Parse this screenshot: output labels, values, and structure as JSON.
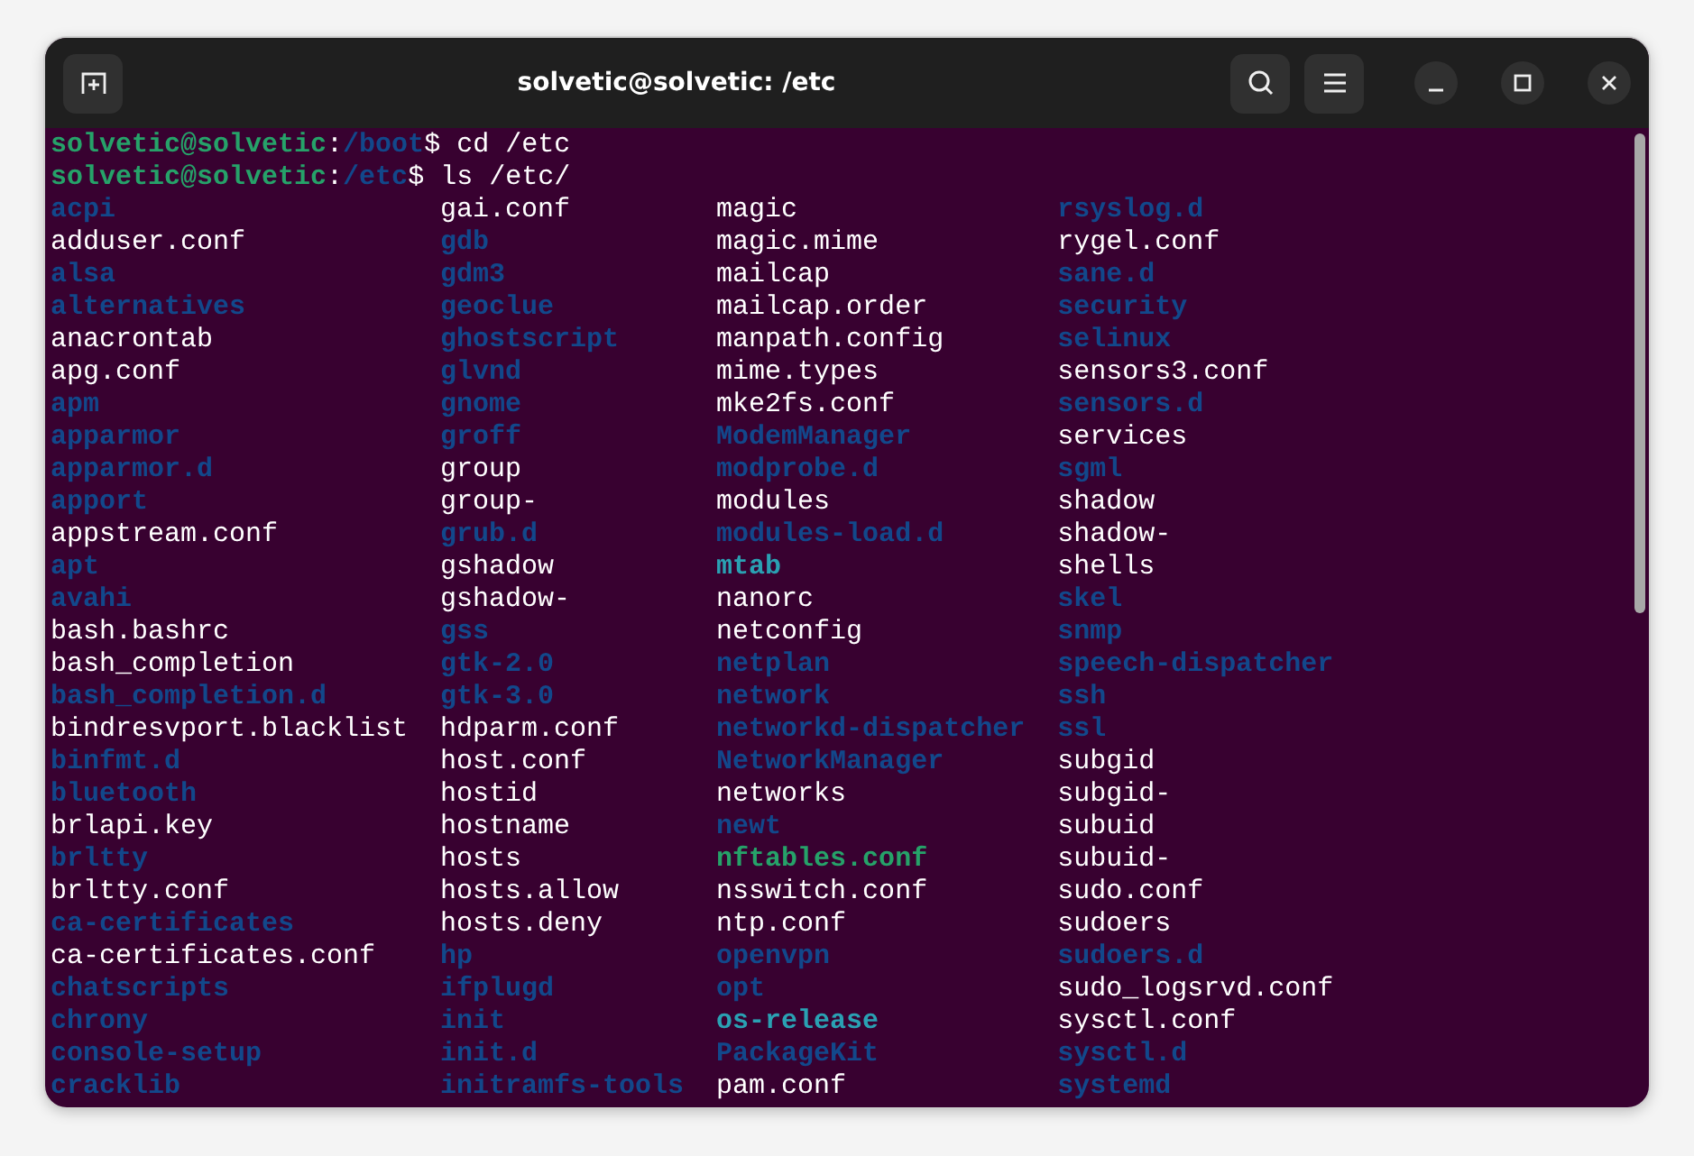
{
  "window": {
    "title": "solvetic@solvetic: /etc"
  },
  "prompts": [
    {
      "user": "solvetic@solvetic",
      "sep": ":",
      "path": "/boot",
      "command": "$ cd /etc"
    },
    {
      "user": "solvetic@solvetic",
      "sep": ":",
      "path": "/etc",
      "command": "$ ls /etc/"
    }
  ],
  "listing": [
    [
      {
        "name": "acpi",
        "kind": "dir"
      },
      {
        "name": "adduser.conf",
        "kind": "file"
      },
      {
        "name": "alsa",
        "kind": "dir"
      },
      {
        "name": "alternatives",
        "kind": "dir"
      },
      {
        "name": "anacrontab",
        "kind": "file"
      },
      {
        "name": "apg.conf",
        "kind": "file"
      },
      {
        "name": "apm",
        "kind": "dir"
      },
      {
        "name": "apparmor",
        "kind": "dir"
      },
      {
        "name": "apparmor.d",
        "kind": "dir"
      },
      {
        "name": "apport",
        "kind": "dir"
      },
      {
        "name": "appstream.conf",
        "kind": "file"
      },
      {
        "name": "apt",
        "kind": "dir"
      },
      {
        "name": "avahi",
        "kind": "dir"
      },
      {
        "name": "bash.bashrc",
        "kind": "file"
      },
      {
        "name": "bash_completion",
        "kind": "file"
      },
      {
        "name": "bash_completion.d",
        "kind": "dir"
      },
      {
        "name": "bindresvport.blacklist",
        "kind": "file"
      },
      {
        "name": "binfmt.d",
        "kind": "dir"
      },
      {
        "name": "bluetooth",
        "kind": "dir"
      },
      {
        "name": "brlapi.key",
        "kind": "file"
      },
      {
        "name": "brltty",
        "kind": "dir"
      },
      {
        "name": "brltty.conf",
        "kind": "file"
      },
      {
        "name": "ca-certificates",
        "kind": "dir"
      },
      {
        "name": "ca-certificates.conf",
        "kind": "file"
      },
      {
        "name": "chatscripts",
        "kind": "dir"
      },
      {
        "name": "chrony",
        "kind": "dir"
      },
      {
        "name": "console-setup",
        "kind": "dir"
      },
      {
        "name": "cracklib",
        "kind": "dir"
      }
    ],
    [
      {
        "name": "gai.conf",
        "kind": "file"
      },
      {
        "name": "gdb",
        "kind": "dir"
      },
      {
        "name": "gdm3",
        "kind": "dir"
      },
      {
        "name": "geoclue",
        "kind": "dir"
      },
      {
        "name": "ghostscript",
        "kind": "dir"
      },
      {
        "name": "glvnd",
        "kind": "dir"
      },
      {
        "name": "gnome",
        "kind": "dir"
      },
      {
        "name": "groff",
        "kind": "dir"
      },
      {
        "name": "group",
        "kind": "file"
      },
      {
        "name": "group-",
        "kind": "file"
      },
      {
        "name": "grub.d",
        "kind": "dir"
      },
      {
        "name": "gshadow",
        "kind": "file"
      },
      {
        "name": "gshadow-",
        "kind": "file"
      },
      {
        "name": "gss",
        "kind": "dir"
      },
      {
        "name": "gtk-2.0",
        "kind": "dir"
      },
      {
        "name": "gtk-3.0",
        "kind": "dir"
      },
      {
        "name": "hdparm.conf",
        "kind": "file"
      },
      {
        "name": "host.conf",
        "kind": "file"
      },
      {
        "name": "hostid",
        "kind": "file"
      },
      {
        "name": "hostname",
        "kind": "file"
      },
      {
        "name": "hosts",
        "kind": "file"
      },
      {
        "name": "hosts.allow",
        "kind": "file"
      },
      {
        "name": "hosts.deny",
        "kind": "file"
      },
      {
        "name": "hp",
        "kind": "dir"
      },
      {
        "name": "ifplugd",
        "kind": "dir"
      },
      {
        "name": "init",
        "kind": "dir"
      },
      {
        "name": "init.d",
        "kind": "dir"
      },
      {
        "name": "initramfs-tools",
        "kind": "dir"
      }
    ],
    [
      {
        "name": "magic",
        "kind": "file"
      },
      {
        "name": "magic.mime",
        "kind": "file"
      },
      {
        "name": "mailcap",
        "kind": "file"
      },
      {
        "name": "mailcap.order",
        "kind": "file"
      },
      {
        "name": "manpath.config",
        "kind": "file"
      },
      {
        "name": "mime.types",
        "kind": "file"
      },
      {
        "name": "mke2fs.conf",
        "kind": "file"
      },
      {
        "name": "ModemManager",
        "kind": "dir"
      },
      {
        "name": "modprobe.d",
        "kind": "dir"
      },
      {
        "name": "modules",
        "kind": "file"
      },
      {
        "name": "modules-load.d",
        "kind": "dir"
      },
      {
        "name": "mtab",
        "kind": "link"
      },
      {
        "name": "nanorc",
        "kind": "file"
      },
      {
        "name": "netconfig",
        "kind": "file"
      },
      {
        "name": "netplan",
        "kind": "dir"
      },
      {
        "name": "network",
        "kind": "dir"
      },
      {
        "name": "networkd-dispatcher",
        "kind": "dir"
      },
      {
        "name": "NetworkManager",
        "kind": "dir"
      },
      {
        "name": "networks",
        "kind": "file"
      },
      {
        "name": "newt",
        "kind": "dir"
      },
      {
        "name": "nftables.conf",
        "kind": "exec"
      },
      {
        "name": "nsswitch.conf",
        "kind": "file"
      },
      {
        "name": "ntp.conf",
        "kind": "file"
      },
      {
        "name": "openvpn",
        "kind": "dir"
      },
      {
        "name": "opt",
        "kind": "dir"
      },
      {
        "name": "os-release",
        "kind": "link"
      },
      {
        "name": "PackageKit",
        "kind": "dir"
      },
      {
        "name": "pam.conf",
        "kind": "file"
      }
    ],
    [
      {
        "name": "rsyslog.d",
        "kind": "dir"
      },
      {
        "name": "rygel.conf",
        "kind": "file"
      },
      {
        "name": "sane.d",
        "kind": "dir"
      },
      {
        "name": "security",
        "kind": "dir"
      },
      {
        "name": "selinux",
        "kind": "dir"
      },
      {
        "name": "sensors3.conf",
        "kind": "file"
      },
      {
        "name": "sensors.d",
        "kind": "dir"
      },
      {
        "name": "services",
        "kind": "file"
      },
      {
        "name": "sgml",
        "kind": "dir"
      },
      {
        "name": "shadow",
        "kind": "file"
      },
      {
        "name": "shadow-",
        "kind": "file"
      },
      {
        "name": "shells",
        "kind": "file"
      },
      {
        "name": "skel",
        "kind": "dir"
      },
      {
        "name": "snmp",
        "kind": "dir"
      },
      {
        "name": "speech-dispatcher",
        "kind": "dir"
      },
      {
        "name": "ssh",
        "kind": "dir"
      },
      {
        "name": "ssl",
        "kind": "dir"
      },
      {
        "name": "subgid",
        "kind": "file"
      },
      {
        "name": "subgid-",
        "kind": "file"
      },
      {
        "name": "subuid",
        "kind": "file"
      },
      {
        "name": "subuid-",
        "kind": "file"
      },
      {
        "name": "sudo.conf",
        "kind": "file"
      },
      {
        "name": "sudoers",
        "kind": "file"
      },
      {
        "name": "sudoers.d",
        "kind": "dir"
      },
      {
        "name": "sudo_logsrvd.conf",
        "kind": "file"
      },
      {
        "name": "sysctl.conf",
        "kind": "file"
      },
      {
        "name": "sysctl.d",
        "kind": "dir"
      },
      {
        "name": "systemd",
        "kind": "dir"
      }
    ]
  ]
}
